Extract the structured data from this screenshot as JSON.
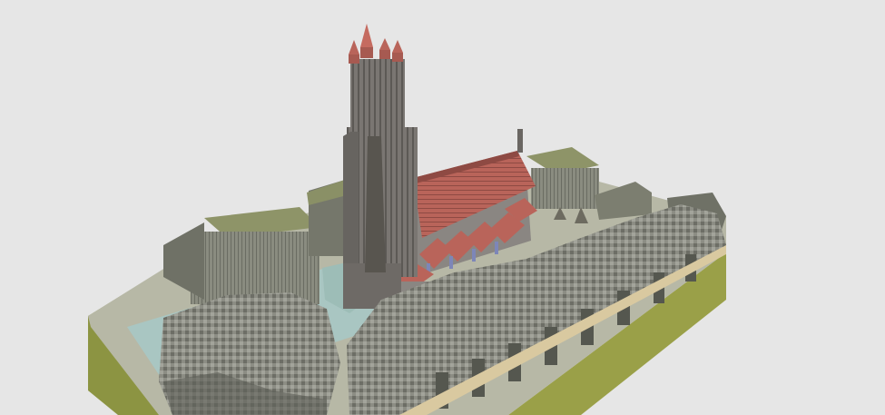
{
  "scene": {
    "subject": "voxel-model-gothic-church-on-terrain-block",
    "colors": {
      "background": "#e6e6e6",
      "stone": "#7a7672",
      "stone_dark": "#5c5955",
      "stone_light": "#9b9893",
      "roof": "#b9645a",
      "roof_dark": "#8e4a43",
      "terrain_side": "#9aa048",
      "terrain_side_dark": "#7e8638",
      "grass_top": "#7d8554",
      "rock": "#8a8c80",
      "rock_dark": "#5d5f56",
      "water": "#a9c6c2",
      "window": "#7d86b8"
    }
  }
}
